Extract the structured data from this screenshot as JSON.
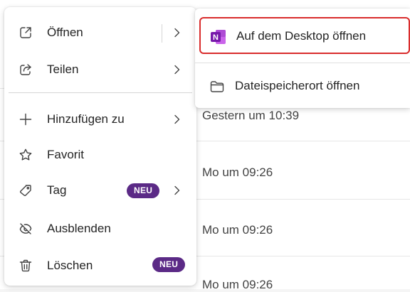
{
  "background_list": {
    "times": [
      "Gestern um 10:39",
      "Mo um 09:26",
      "Mo um 09:26",
      "Mo um 09:26"
    ]
  },
  "menu": {
    "items": [
      {
        "label": "Öffnen",
        "icon": "open-external-icon",
        "has_submenu": true
      },
      {
        "label": "Teilen",
        "icon": "share-icon",
        "has_submenu": true
      },
      {
        "label": "Hinzufügen zu",
        "icon": "plus-icon",
        "has_submenu": true
      },
      {
        "label": "Favorit",
        "icon": "star-icon",
        "has_submenu": false
      },
      {
        "label": "Tag",
        "icon": "tag-icon",
        "has_submenu": true,
        "badge": "NEU"
      },
      {
        "label": "Ausblenden",
        "icon": "eye-off-icon",
        "has_submenu": false
      },
      {
        "label": "Löschen",
        "icon": "trash-icon",
        "has_submenu": false,
        "badge": "NEU"
      }
    ]
  },
  "submenu": {
    "items": [
      {
        "label": "Auf dem Desktop öffnen",
        "icon": "onenote-icon"
      },
      {
        "label": "Dateispeicherort öffnen",
        "icon": "folder-icon"
      }
    ]
  },
  "colors": {
    "badge": "#5b2a86",
    "focus_outline": "#d92c2c",
    "onenote": "#7719aa"
  }
}
